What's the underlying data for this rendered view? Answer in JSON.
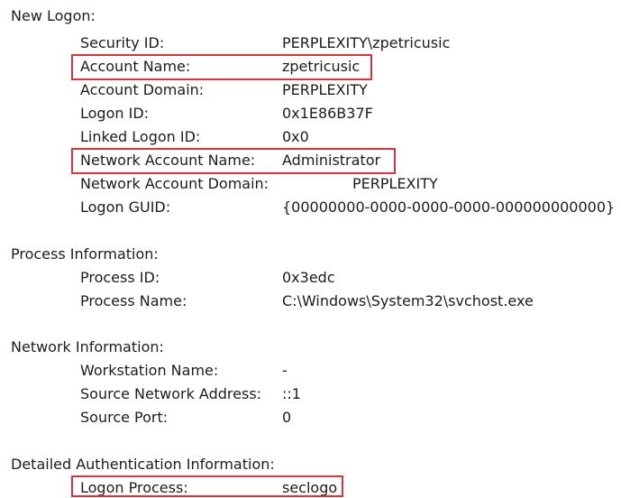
{
  "colors": {
    "text": "#1c1c1c",
    "highlight": "#d0363e",
    "background": "#ffffff"
  },
  "new_logon": {
    "header": "New Logon:",
    "security_id": {
      "label": "Security ID:",
      "value": "PERPLEXITY\\zpetricusic"
    },
    "account_name": {
      "label": "Account Name:",
      "value": "zpetricusic"
    },
    "account_domain": {
      "label": "Account Domain:",
      "value": "PERPLEXITY"
    },
    "logon_id": {
      "label": "Logon ID:",
      "value": "0x1E86B37F"
    },
    "linked_logon_id": {
      "label": "Linked Logon ID:",
      "value": "0x0"
    },
    "network_account_name": {
      "label": "Network Account Name:",
      "value": "Administrator"
    },
    "network_account_domain": {
      "label": "Network Account Domain:",
      "value": "PERPLEXITY"
    },
    "logon_guid": {
      "label": "Logon GUID:",
      "value": "{00000000-0000-0000-0000-000000000000}"
    }
  },
  "process_information": {
    "header": "Process Information:",
    "process_id": {
      "label": "Process ID:",
      "value": "0x3edc"
    },
    "process_name": {
      "label": "Process Name:",
      "value": "C:\\Windows\\System32\\svchost.exe"
    }
  },
  "network_information": {
    "header": "Network Information:",
    "workstation_name": {
      "label": "Workstation Name:",
      "value": "-"
    },
    "source_network_address": {
      "label": "Source Network Address:",
      "value": "::1"
    },
    "source_port": {
      "label": "Source Port:",
      "value": "0"
    }
  },
  "detailed_authentication": {
    "header": "Detailed Authentication Information:",
    "logon_process": {
      "label": "Logon Process:",
      "value": "seclogo"
    }
  }
}
